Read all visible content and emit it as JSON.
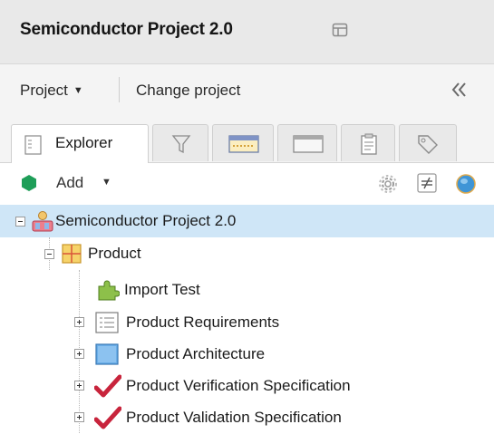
{
  "header": {
    "title": "Semiconductor Project 2.0"
  },
  "project_bar": {
    "project_menu": "Project",
    "change_project": "Change project"
  },
  "tabs": [
    {
      "label": "Explorer",
      "icon": "explorer-icon",
      "active": true
    },
    {
      "label": "",
      "icon": "filter-icon",
      "active": false
    },
    {
      "label": "",
      "icon": "timeline-icon",
      "active": false
    },
    {
      "label": "",
      "icon": "window-icon",
      "active": false
    },
    {
      "label": "",
      "icon": "clipboard-icon",
      "active": false
    },
    {
      "label": "",
      "icon": "tag-icon",
      "active": false
    }
  ],
  "toolbar": {
    "add_label": "Add"
  },
  "tree": {
    "root": {
      "label": "Semiconductor Project 2.0",
      "icon": "project-icon",
      "expanded": true
    },
    "product": {
      "label": "Product",
      "icon": "folder-grid-icon",
      "expanded": true
    },
    "children": [
      {
        "label": "Import Test",
        "icon": "puzzle-icon",
        "expandable": false
      },
      {
        "label": "Product Requirements",
        "icon": "document-list-icon",
        "expandable": true
      },
      {
        "label": "Product Architecture",
        "icon": "architecture-icon",
        "expandable": true
      },
      {
        "label": "Product Verification Specification",
        "icon": "checkmark-icon",
        "expandable": true
      },
      {
        "label": "Product Validation Specification",
        "icon": "checkmark-icon",
        "expandable": true
      }
    ]
  },
  "colors": {
    "selected_row": "#cfe6f7",
    "check_red": "#c8243c",
    "add_green": "#1e9e58",
    "header_bg": "#e9e9e9"
  }
}
